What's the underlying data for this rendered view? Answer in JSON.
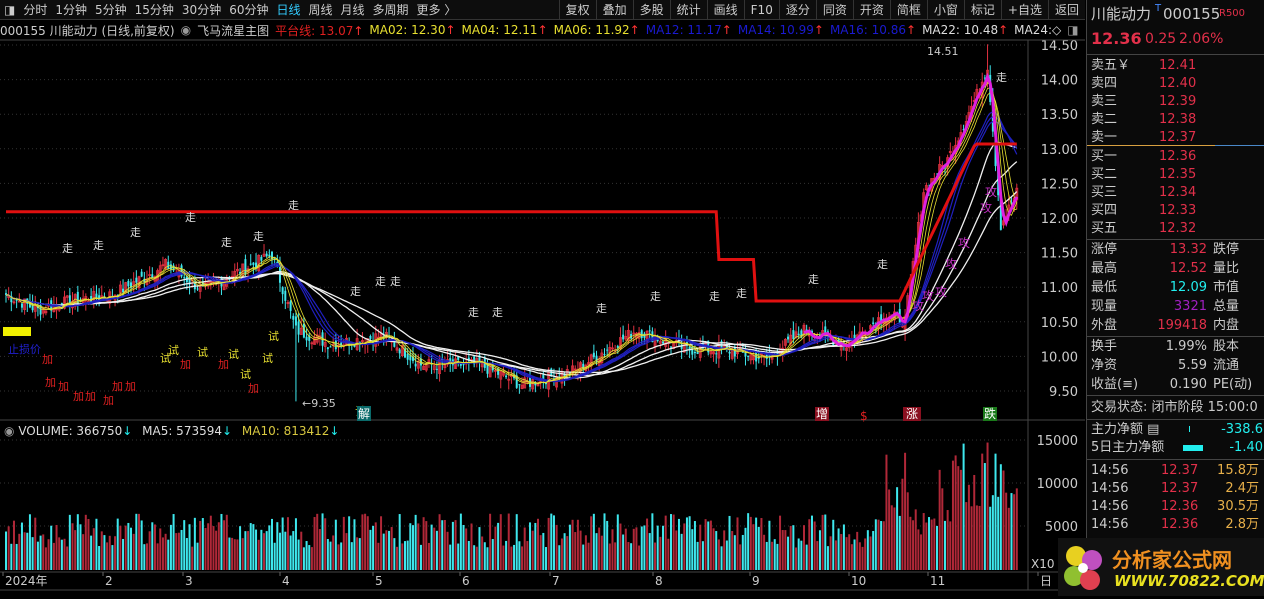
{
  "toolbar": {
    "periods": [
      "分时",
      "1分钟",
      "5分钟",
      "15分钟",
      "30分钟",
      "60分钟",
      "日线",
      "周线",
      "月线",
      "多周期",
      "更多 〉"
    ],
    "active": "日线",
    "buttons": [
      "复权",
      "叠加",
      "多股",
      "统计",
      "画线",
      "F10",
      "逐分",
      "同资",
      "开资",
      "简框",
      "小窗",
      "标记",
      "+自选",
      "返回"
    ]
  },
  "info": {
    "title": "000155 川能动力 (日线,前复权)",
    "indicator": "飞马流星主图",
    "items": [
      {
        "label": "平台线: 13.07",
        "color": "#e02020"
      },
      {
        "label": "MA02: 12.30",
        "color": "#e8e030"
      },
      {
        "label": "MA04: 12.11",
        "color": "#e8e030"
      },
      {
        "label": "MA06: 11.92",
        "color": "#e8e030"
      },
      {
        "label": "MA12: 11.17",
        "color": "#1a1ad0"
      },
      {
        "label": "MA14: 10.99",
        "color": "#1a1ad0"
      },
      {
        "label": "MA16: 10.86",
        "color": "#1a1ad0"
      },
      {
        "label": "MA22: 10.48",
        "color": "#dddddd"
      },
      {
        "label": "MA24:◇",
        "color": "#dddddd"
      }
    ],
    "arrow": "↑"
  },
  "volume_info": {
    "volume": "VOLUME: 366750",
    "ma5": "MA5: 573594",
    "ma10": "MA10: 813412",
    "arrow": "↓"
  },
  "markers": {
    "walk": "走",
    "add": "加",
    "try": "试",
    "attack": "攻",
    "unlock": "解",
    "increase": "增",
    "dollar": "$",
    "rise": "涨",
    "fall": "跌",
    "stop_loss": "止损价",
    "low_label": "←9.35",
    "high_label": "14.51"
  },
  "chart_data": {
    "type": "candlestick",
    "price_axis": [
      "14.50",
      "14.00",
      "13.50",
      "13.00",
      "12.50",
      "12.00",
      "11.50",
      "11.00",
      "10.50",
      "10.00",
      "9.50"
    ],
    "ylim": [
      9.3,
      14.6
    ],
    "volume_axis": [
      "15000",
      "10000",
      "5000"
    ],
    "volume_unit": "X10",
    "x_labels": [
      "2024年",
      "2",
      "3",
      "4",
      "5",
      "6",
      "7",
      "8",
      "9",
      "10",
      "11",
      "日"
    ],
    "close_path": [
      [
        0,
        10.89
      ],
      [
        12,
        10.67
      ],
      [
        24,
        10.8
      ],
      [
        40,
        10.89
      ],
      [
        60,
        11.32
      ],
      [
        74,
        10.96
      ],
      [
        100,
        11.47
      ],
      [
        109,
        10.38
      ],
      [
        122,
        10.17
      ],
      [
        142,
        10.3
      ],
      [
        156,
        9.88
      ],
      [
        178,
        9.88
      ],
      [
        194,
        9.59
      ],
      [
        214,
        9.8
      ],
      [
        237,
        10.38
      ],
      [
        256,
        10.1
      ],
      [
        270,
        10.1
      ],
      [
        286,
        9.96
      ],
      [
        300,
        10.38
      ],
      [
        316,
        10.17
      ],
      [
        330,
        10.6
      ],
      [
        338,
        10.52
      ],
      [
        345,
        12.4
      ],
      [
        354,
        12.84
      ],
      [
        365,
        13.78
      ],
      [
        369,
        14.2
      ],
      [
        374,
        11.9
      ],
      [
        380,
        12.36
      ]
    ],
    "high": 14.51,
    "low": 9.35,
    "platform": 13.07
  },
  "quote": {
    "name": "川能动力",
    "t": "T",
    "code": "000155",
    "r": "R500",
    "price": "12.36",
    "change": "0.25",
    "pct": "2.06%"
  },
  "asks": [
    {
      "l": "卖五￥",
      "p": "12.41"
    },
    {
      "l": "卖四",
      "p": "12.40"
    },
    {
      "l": "卖三",
      "p": "12.39"
    },
    {
      "l": "卖二",
      "p": "12.38"
    },
    {
      "l": "卖一",
      "p": "12.37"
    }
  ],
  "bids": [
    {
      "l": "买一",
      "p": "12.36"
    },
    {
      "l": "买二",
      "p": "12.35"
    },
    {
      "l": "买三",
      "p": "12.34"
    },
    {
      "l": "买四",
      "p": "12.33"
    },
    {
      "l": "买五",
      "p": "12.32"
    }
  ],
  "stats": [
    {
      "l": "涨停",
      "v": "13.32",
      "r": "跌停",
      "c": "red"
    },
    {
      "l": "最高",
      "v": "12.52",
      "r": "量比",
      "c": "red"
    },
    {
      "l": "最低",
      "v": "12.09",
      "r": "市值",
      "c": "cy"
    },
    {
      "l": "现量",
      "v": "3321",
      "r": "总量",
      "c": "pu"
    },
    {
      "l": "外盘",
      "v": "199418",
      "r": "内盘",
      "c": "red"
    }
  ],
  "stats2": [
    {
      "l": "换手",
      "v": "1.99%",
      "r": "股本"
    },
    {
      "l": "净资",
      "v": "5.59",
      "r": "流通"
    },
    {
      "l": "收益(≡)",
      "v": "0.190",
      "r": "PE(动)"
    }
  ],
  "status": "交易状态: 闭市阶段 15:00:0",
  "flow": [
    {
      "l": "主力净额 ▤",
      "v": "-338.6"
    },
    {
      "l": "5日主力净额",
      "v": "-1.40"
    }
  ],
  "ticks": [
    {
      "t": "14:56",
      "p": "12.37",
      "v": "15.8万"
    },
    {
      "t": "14:56",
      "p": "12.37",
      "v": "2.4万"
    },
    {
      "t": "14:56",
      "p": "12.36",
      "v": "30.5万"
    },
    {
      "t": "14:56",
      "p": "12.36",
      "v": "2.8万"
    }
  ],
  "logo": {
    "cn": "分析家公式网",
    "url": "WWW.70822.COM"
  }
}
